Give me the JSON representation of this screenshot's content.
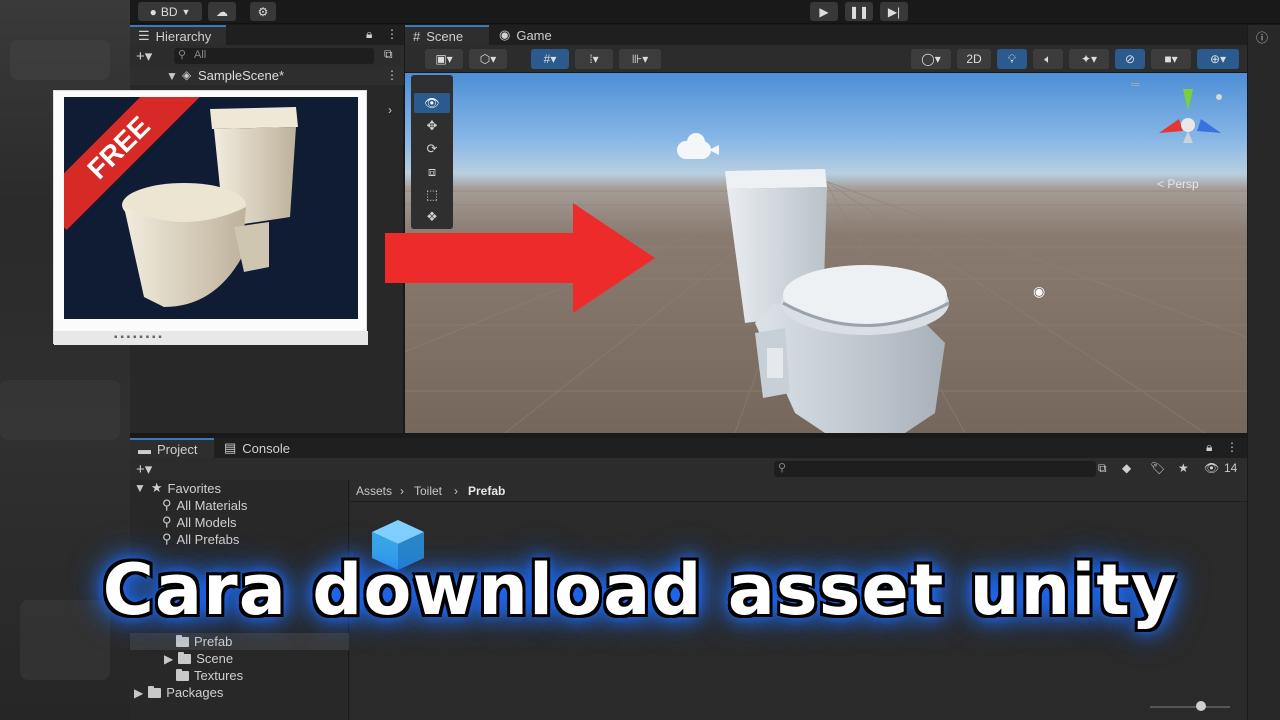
{
  "toolbar": {
    "account": "BD",
    "play_icon": "play-icon",
    "pause_icon": "pause-icon",
    "step_icon": "step-icon"
  },
  "hierarchy": {
    "tab_label": "Hierarchy",
    "search_placeholder": "All",
    "scene_name": "SampleScene*"
  },
  "scene": {
    "tab_scene": "Scene",
    "tab_game": "Game",
    "mode_2d": "2D",
    "persp_label": "< Persp"
  },
  "thumbnail": {
    "badge": "FREE"
  },
  "project": {
    "tab_project": "Project",
    "tab_console": "Console",
    "breadcrumb": [
      "Assets",
      "Toilet",
      "Prefab"
    ],
    "visible_count": "14",
    "favorites_label": "Favorites",
    "favorites": [
      "All Materials",
      "All Models",
      "All Prefabs"
    ],
    "folders": [
      "Prefab",
      "Scene",
      "Textures"
    ],
    "packages_label": "Packages"
  },
  "caption": "Cara download asset unity",
  "colors": {
    "accent": "#3a79bb",
    "arrow": "#ee2b2b",
    "caption_glow": "#1d6cff"
  }
}
